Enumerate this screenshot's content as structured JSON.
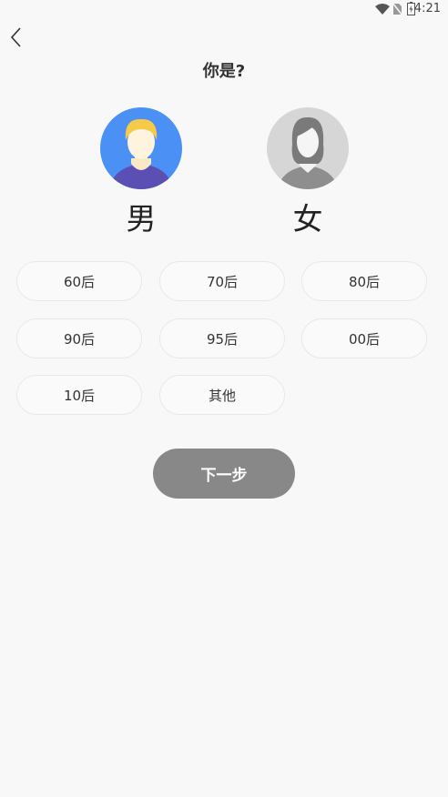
{
  "status_bar": {
    "time": "4:21",
    "icons": [
      "wifi-icon",
      "no-sim-icon",
      "battery-charging-icon"
    ]
  },
  "header": {
    "back_icon": "chevron-left-icon",
    "title": "你是?"
  },
  "gender": {
    "male": {
      "label": "男",
      "avatar": "male-avatar-icon"
    },
    "female": {
      "label": "女",
      "avatar": "female-avatar-icon"
    }
  },
  "age_options": [
    "60后",
    "70后",
    "80后",
    "90后",
    "95后",
    "00后",
    "10后",
    "其他"
  ],
  "next_button": {
    "label": "下一步"
  },
  "colors": {
    "background": "#f8f8f8",
    "button_disabled": "#888888",
    "male_avatar_bg": "#4a90f5",
    "female_avatar_bg": "#d6d6d6"
  }
}
